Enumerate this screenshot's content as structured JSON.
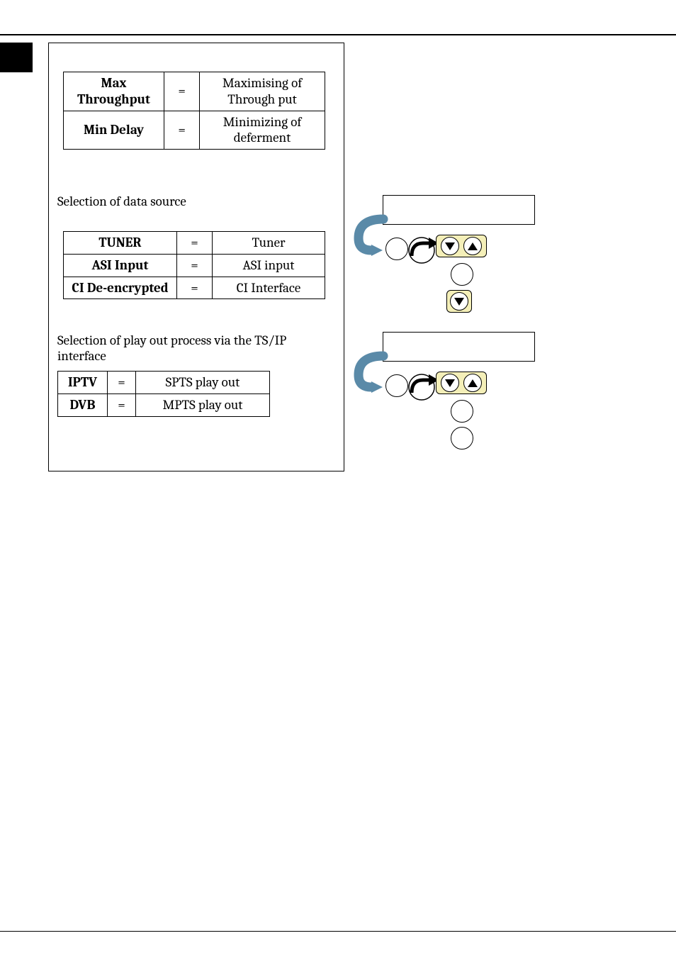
{
  "table1": {
    "rows": [
      {
        "term": "Max Throughput",
        "def": "Maximising of Through put"
      },
      {
        "term": "Min Delay",
        "def": "Minimizing of deferment"
      }
    ]
  },
  "section2": {
    "heading": "Selection of data source",
    "rows": [
      {
        "term": "TUNER",
        "def": "Tuner"
      },
      {
        "term": "ASI Input",
        "def": "ASI input"
      },
      {
        "term": "CI De-encrypted",
        "def": "CI Interface"
      }
    ]
  },
  "section3": {
    "heading": "Selection of play out process via the TS/IP interface",
    "rows": [
      {
        "term": "IPTV",
        "def": "SPTS play out"
      },
      {
        "term": "DVB",
        "def": "MPTS play out"
      }
    ]
  },
  "equals": "="
}
